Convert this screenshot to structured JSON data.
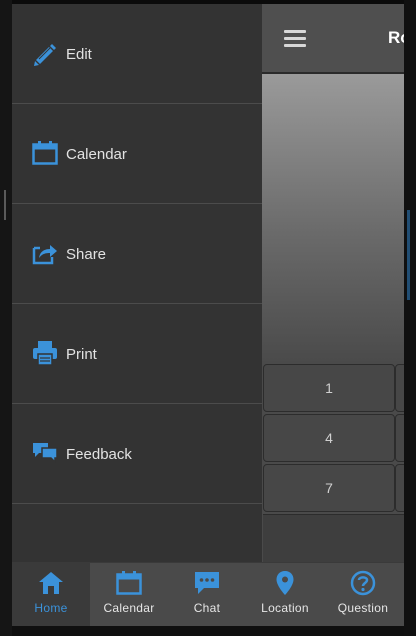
{
  "colors": {
    "accent": "#3b92da",
    "drawer_bg": "#333333",
    "divider": "#4c4c4c",
    "bar_bg": "#4f4f4f"
  },
  "actionbar": {
    "title": "Ro"
  },
  "keypad": {
    "keys": [
      "1",
      "4",
      "7"
    ]
  },
  "drawer": {
    "items": [
      {
        "label": "Edit",
        "icon": "pencil-icon"
      },
      {
        "label": "Calendar",
        "icon": "calendar-icon"
      },
      {
        "label": "Share",
        "icon": "share-icon"
      },
      {
        "label": "Print",
        "icon": "printer-icon"
      },
      {
        "label": "Feedback",
        "icon": "chat-bubbles-icon"
      }
    ]
  },
  "bottomnav": {
    "active": "Home",
    "tabs": [
      {
        "label": "Home",
        "icon": "home-icon"
      },
      {
        "label": "Calendar",
        "icon": "calendar-icon"
      },
      {
        "label": "Chat",
        "icon": "chat-icon"
      },
      {
        "label": "Location",
        "icon": "location-pin-icon"
      },
      {
        "label": "Question",
        "icon": "help-icon"
      }
    ]
  }
}
